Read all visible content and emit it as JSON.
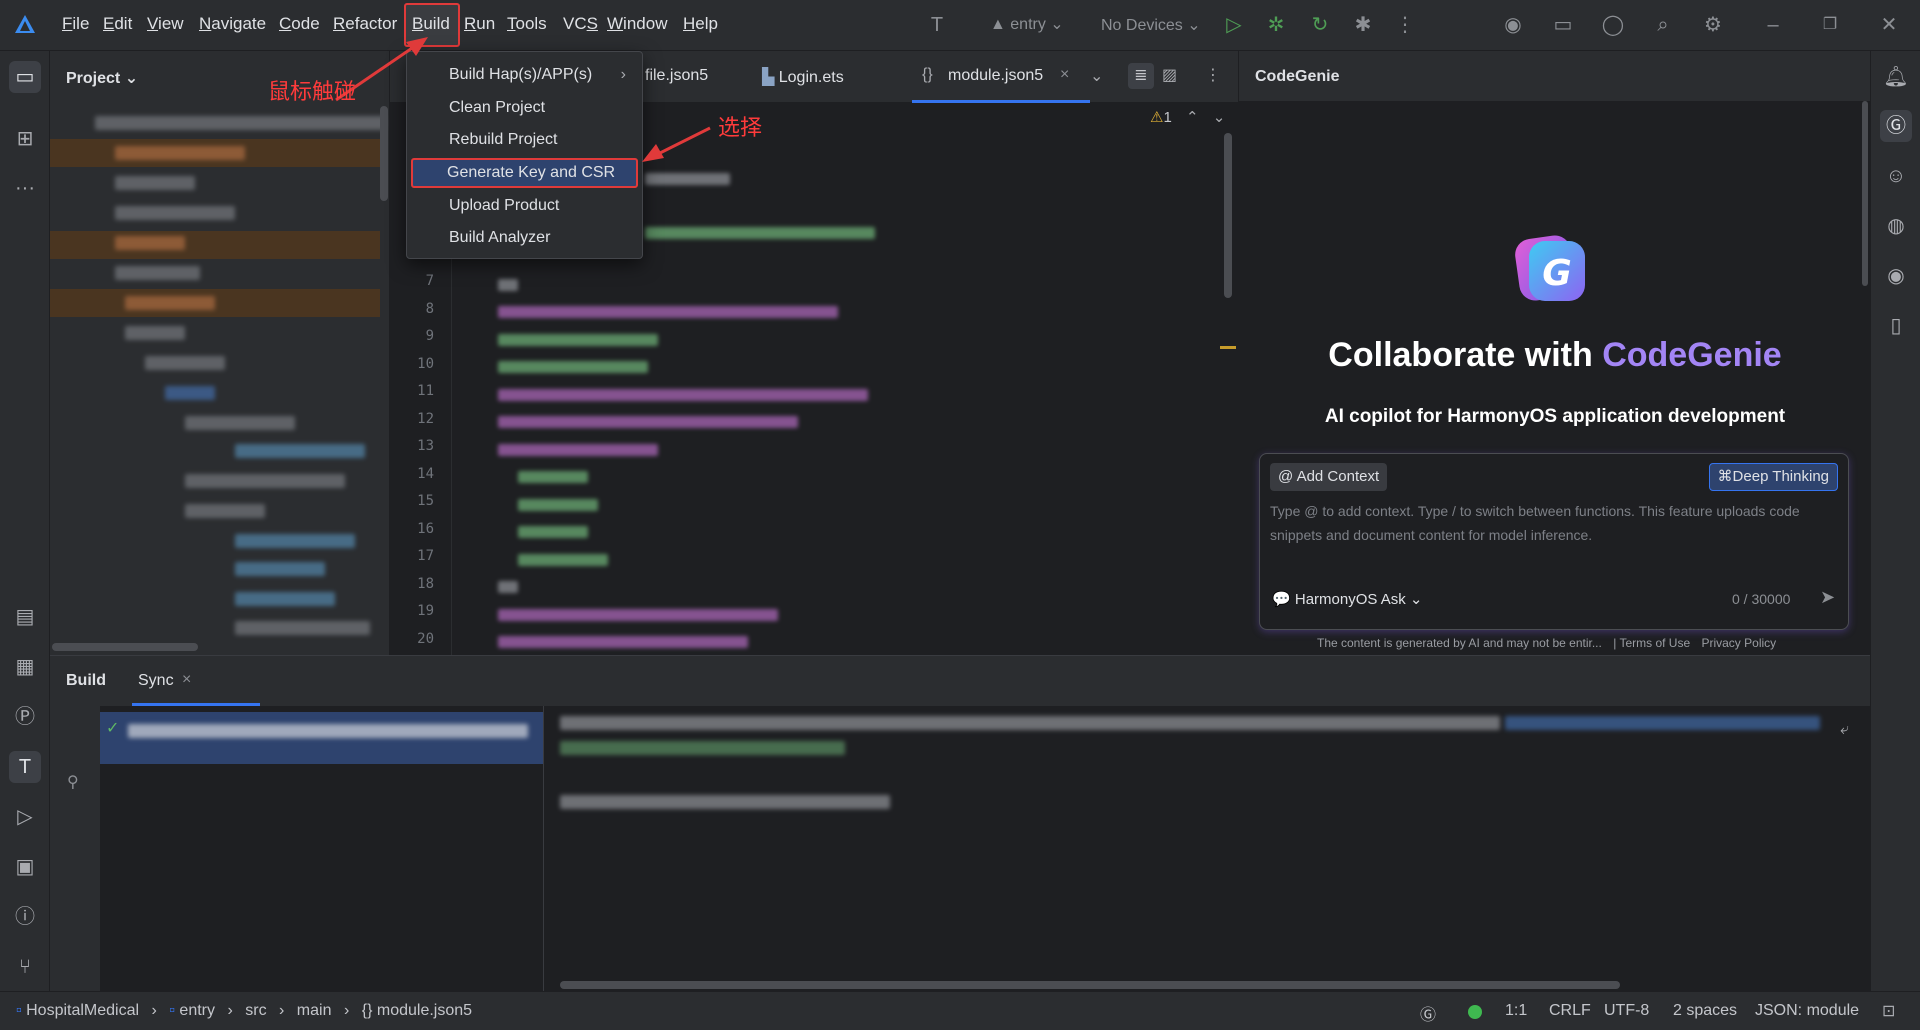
{
  "menu": {
    "items": [
      "File",
      "Edit",
      "View",
      "Navigate",
      "Code",
      "Refactor",
      "Build",
      "Run",
      "Tools",
      "VCS",
      "Window",
      "Help"
    ],
    "mnemonics": [
      "F",
      "E",
      "V",
      "N",
      "C",
      "R",
      "B",
      "R",
      "T",
      "S",
      "W",
      "H"
    ]
  },
  "toolbar": {
    "run_config": "entry",
    "device": "No Devices"
  },
  "project_panel": {
    "title": "Project"
  },
  "tabs": [
    {
      "label": "file.json5"
    },
    {
      "label": "Login.ets"
    },
    {
      "label": "module.json5",
      "active": true
    }
  ],
  "editor": {
    "warning_count": "1",
    "line_numbers": [
      "7",
      "8",
      "9",
      "10",
      "11",
      "12",
      "13",
      "14",
      "15",
      "16",
      "17",
      "18",
      "19",
      "20"
    ]
  },
  "build_menu": {
    "items": [
      "Build Hap(s)/APP(s)",
      "Clean Project",
      "Rebuild Project",
      "Generate Key and CSR",
      "Upload Product",
      "Build Analyzer"
    ],
    "selected": "Generate Key and CSR"
  },
  "annotations": {
    "hover": "鼠标触碰",
    "select": "选择"
  },
  "codegenie": {
    "header": "CodeGenie",
    "headline_prefix": "Collaborate with ",
    "headline_brand": "CodeGenie",
    "subtitle": "AI copilot for HarmonyOS application development",
    "add_context": "@ Add Context",
    "deep_thinking": "Deep Thinking",
    "input_placeholder": "Type @ to add context. Type / to switch between functions. This feature uploads code snippets and document content for model inference.",
    "mode": "HarmonyOS Ask",
    "counter": "0 / 30000",
    "disclaimer": "The content is generated by AI and may not be entir...",
    "terms": "| Terms of Use",
    "privacy": "Privacy Policy"
  },
  "build_panel": {
    "tab_build": "Build",
    "tab_sync": "Sync"
  },
  "statusbar": {
    "breadcrumb": [
      "HospitalMedical",
      "entry",
      "src",
      "main",
      "module.json5"
    ],
    "position": "1:1",
    "line_ending": "CRLF",
    "encoding": "UTF-8",
    "indent": "2 spaces",
    "file_type": "JSON: module"
  },
  "colors": {
    "accent": "#3574f0",
    "brand_purple": "#a385f5",
    "annotation_red": "#e03a3a",
    "background": "#1e1f22",
    "panel": "#2b2d30"
  }
}
